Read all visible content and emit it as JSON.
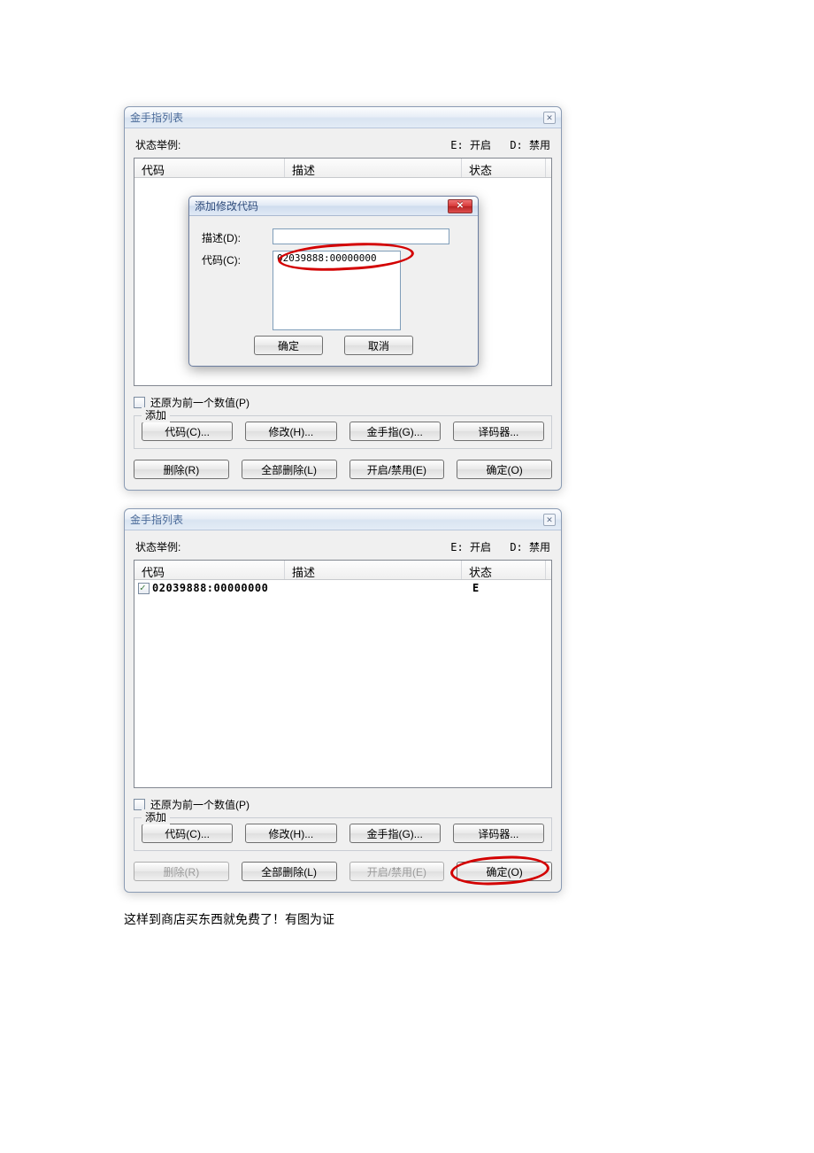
{
  "window1": {
    "title": "金手指列表",
    "status_label": "状态举例:",
    "status_e": "E: 开启",
    "status_d": "D: 禁用",
    "headers": {
      "code": "代码",
      "desc": "描述",
      "state": "状态"
    },
    "restore_label": "还原为前一个数值(P)",
    "add_legend": "添加",
    "buttons_add": {
      "code": "代码(C)...",
      "modify": "修改(H)...",
      "cheat": "金手指(G)...",
      "decoder": "译码器..."
    },
    "buttons_actions": {
      "delete": "删除(R)",
      "delete_all": "全部删除(L)",
      "toggle": "开启/禁用(E)",
      "ok": "确定(O)"
    },
    "popup": {
      "title": "添加修改代码",
      "desc_label": "描述(D):",
      "code_label": "代码(C):",
      "code_value": "02039888:00000000",
      "ok": "确定",
      "cancel": "取消"
    }
  },
  "window2": {
    "title": "金手指列表",
    "status_label": "状态举例:",
    "status_e": "E: 开启",
    "status_d": "D: 禁用",
    "headers": {
      "code": "代码",
      "desc": "描述",
      "state": "状态"
    },
    "row1": {
      "code": "02039888:00000000",
      "state": "E"
    },
    "restore_label": "还原为前一个数值(P)",
    "add_legend": "添加",
    "buttons_add": {
      "code": "代码(C)...",
      "modify": "修改(H)...",
      "cheat": "金手指(G)...",
      "decoder": "译码器..."
    },
    "buttons_actions": {
      "delete": "删除(R)",
      "delete_all": "全部删除(L)",
      "toggle": "开启/禁用(E)",
      "ok": "确定(O)"
    }
  },
  "caption": "这样到商店买东西就免费了！有图为证"
}
